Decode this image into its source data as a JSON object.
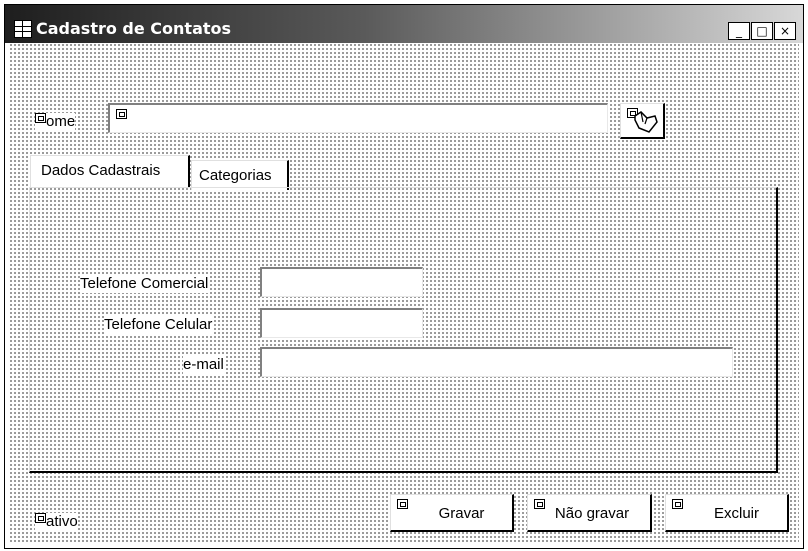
{
  "window": {
    "title": "Cadastro de Contatos",
    "controls": {
      "minimize": "_",
      "maximize": "□",
      "close": "×"
    }
  },
  "nome": {
    "label": "Nome",
    "label_display": "ome",
    "value": ""
  },
  "tabs": [
    {
      "label": "Dados Cadastrais"
    },
    {
      "label": "Categorias"
    }
  ],
  "fields": [
    {
      "label": "Telefone Comercial",
      "value": ""
    },
    {
      "label": "Telefone Celular",
      "value": ""
    },
    {
      "label": "e-mail",
      "value": ""
    }
  ],
  "ativo": {
    "label_display": "ativo"
  },
  "buttons": {
    "gravar": "Gravar",
    "nao_gravar": "Não gravar",
    "excluir": "Excluir"
  },
  "icons": {
    "app": "form-icon",
    "search": "search-pointer-icon",
    "placeholder": "component-placeholder-icon"
  }
}
